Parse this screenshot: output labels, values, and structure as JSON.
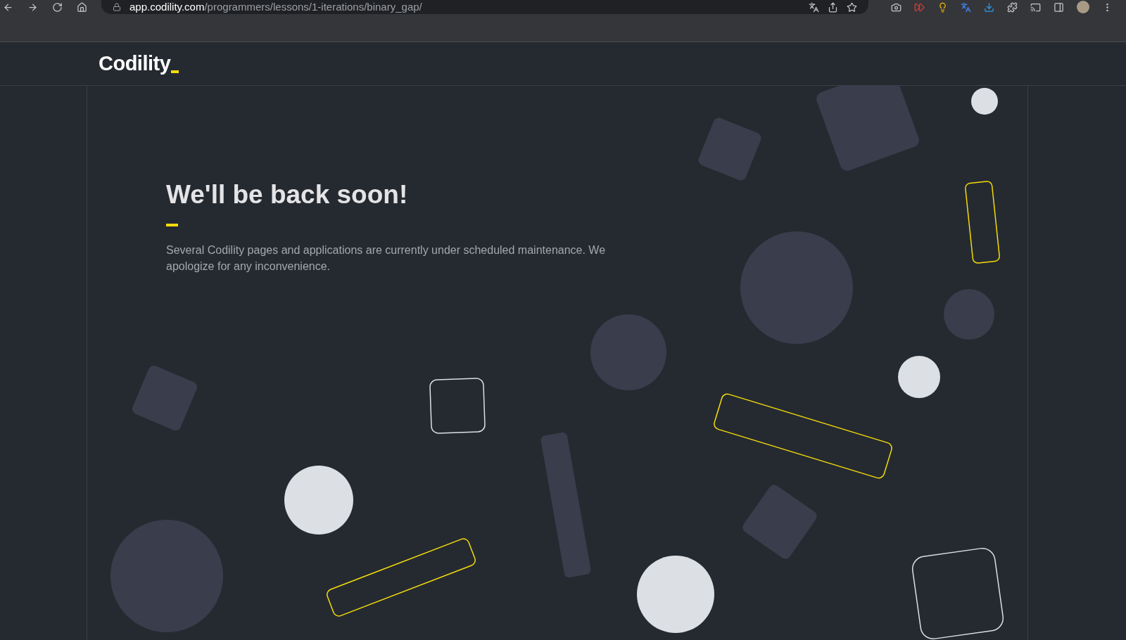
{
  "browser": {
    "url_host": "app.codility.com",
    "url_path": "/programmers/lessons/1-iterations/binary_gap/"
  },
  "header": {
    "logo": "Codility"
  },
  "notice": {
    "title": "We'll be back soon!",
    "message": "Several Codility pages and applications are currently under scheduled maintenance. We apologize for any inconvenience."
  }
}
